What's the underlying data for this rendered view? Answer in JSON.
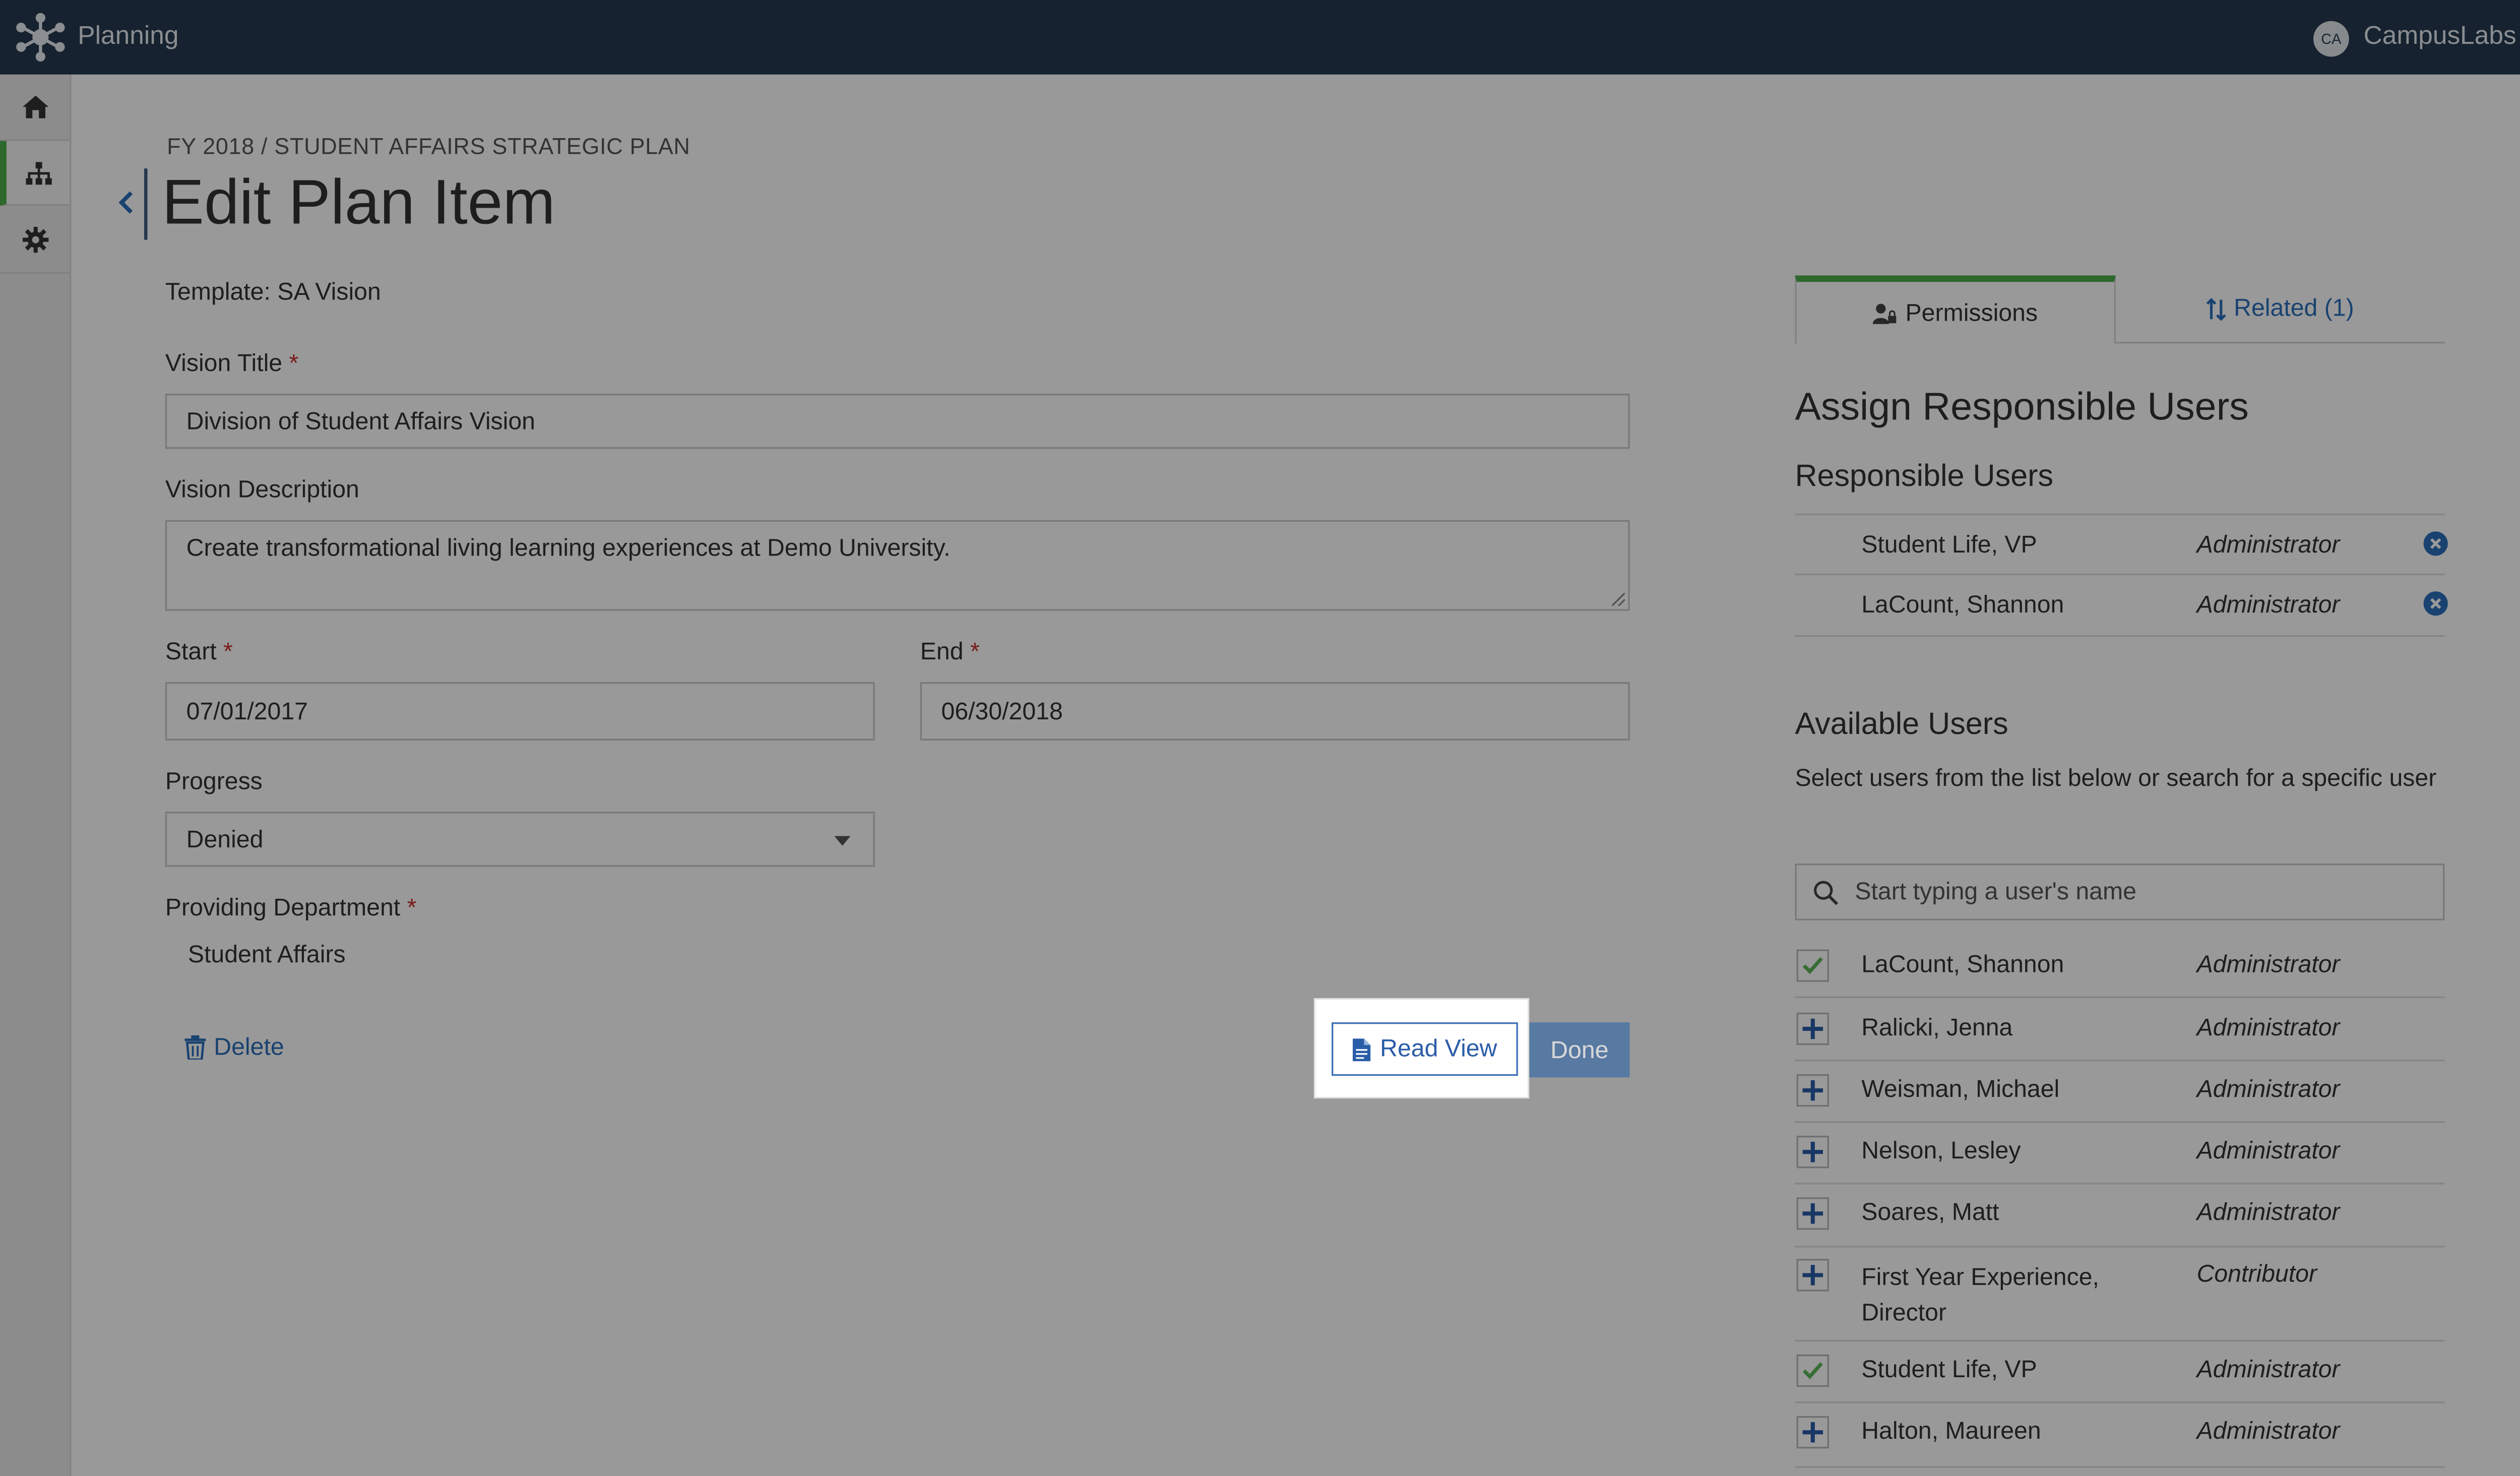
{
  "app": {
    "title": "Planning",
    "user_initials": "CA",
    "user_name": "CampusLabs"
  },
  "nav": [
    {
      "icon": "home-icon"
    },
    {
      "icon": "hierarchy-icon",
      "active": true
    },
    {
      "icon": "gear-icon"
    }
  ],
  "breadcrumb": "FY 2018 / STUDENT AFFAIRS STRATEGIC PLAN",
  "page_title": "Edit Plan Item",
  "form": {
    "template_label": "Template: SA Vision",
    "vision_title_label": "Vision Title",
    "vision_title_value": "Division of Student Affairs Vision",
    "vision_description_label": "Vision Description",
    "vision_description_value": "Create transformational living learning experiences at Demo University.",
    "start_label": "Start",
    "start_value": "07/01/2017",
    "end_label": "End",
    "end_value": "06/30/2018",
    "progress_label": "Progress",
    "progress_value": "Denied",
    "department_label": "Providing Department",
    "department_value": "Student Affairs",
    "required_mark": "*"
  },
  "actions": {
    "delete": "Delete",
    "read_view": "Read View",
    "done": "Done"
  },
  "tabs": {
    "permissions": "Permissions",
    "related": "Related (1)"
  },
  "panel": {
    "heading": "Assign Responsible Users",
    "responsible_heading": "Responsible Users",
    "responsible": [
      {
        "name": "Student Life,   VP",
        "role": "Administrator"
      },
      {
        "name": "LaCount,   Shannon",
        "role": "Administrator"
      }
    ],
    "available_heading": "Available Users",
    "available_help": "Select users from the list below or search for a specific user",
    "search_placeholder": "Start typing a user's name",
    "available": [
      {
        "name": "LaCount,   Shannon",
        "role": "Administrator",
        "state": "checked"
      },
      {
        "name": "Ralicki,   Jenna",
        "role": "Administrator",
        "state": "add"
      },
      {
        "name": "Weisman,   Michael",
        "role": "Administrator",
        "state": "add"
      },
      {
        "name": "Nelson,   Lesley",
        "role": "Administrator",
        "state": "add"
      },
      {
        "name": "Soares,   Matt",
        "role": "Administrator",
        "state": "add"
      },
      {
        "name": "First Year Experience, Director",
        "role": "Contributor",
        "state": "add"
      },
      {
        "name": "Student Life,   VP",
        "role": "Administrator",
        "state": "checked"
      },
      {
        "name": "Halton,   Maureen",
        "role": "Administrator",
        "state": "add"
      }
    ]
  },
  "colors": {
    "topbar": "#25394f",
    "accent_green": "#4cae4c",
    "link_blue": "#2a6ebb",
    "primary": "#2f67a8",
    "required": "#c9302c"
  }
}
